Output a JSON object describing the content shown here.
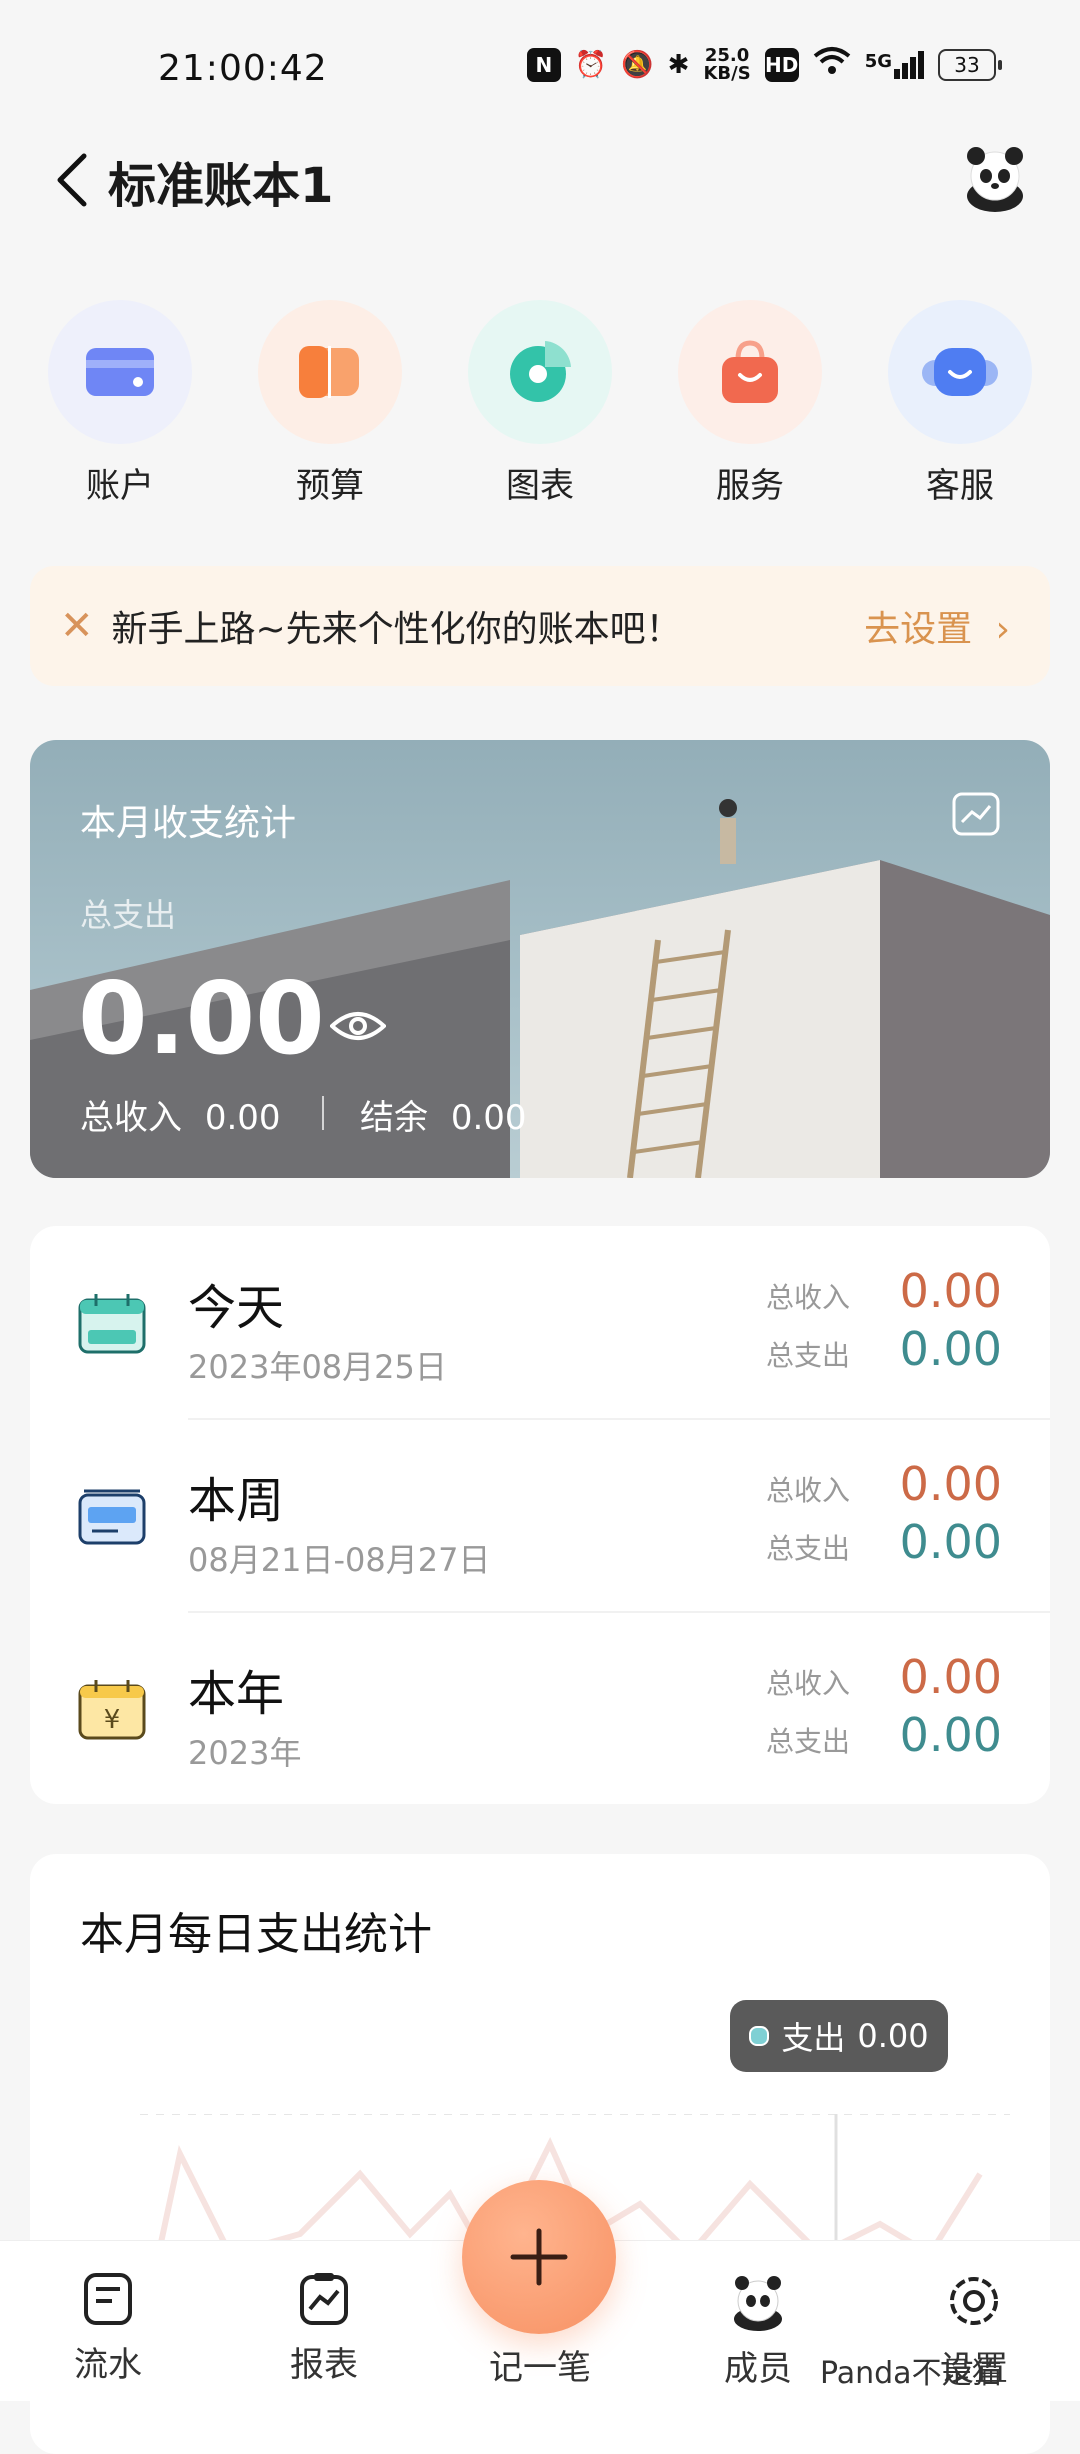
{
  "status_bar": {
    "time": "21:00:42",
    "icons": [
      "nfc-icon",
      "alarm-icon",
      "mute-icon",
      "bluetooth-icon"
    ],
    "net_speed_value": "25.0",
    "net_speed_unit": "KB/S",
    "hd": "HD",
    "network": "5G",
    "battery": "33"
  },
  "header": {
    "title": "标准账本1"
  },
  "quick_actions": [
    {
      "label": "账户",
      "icon": "card-icon",
      "color": "#6f86f5",
      "bg": "#eef0fb"
    },
    {
      "label": "预算",
      "icon": "budget-icon",
      "color": "#f77f3c",
      "bg": "#fdeee6"
    },
    {
      "label": "图表",
      "icon": "pie-chart-icon",
      "color": "#33c3a9",
      "bg": "#e6f7f3"
    },
    {
      "label": "服务",
      "icon": "bag-icon",
      "color": "#f1694f",
      "bg": "#fdeee8"
    },
    {
      "label": "客服",
      "icon": "headset-icon",
      "color": "#4f7df2",
      "bg": "#e9f0fc"
    }
  ],
  "banner": {
    "text": "新手上路~先来个性化你的账本吧！",
    "action": "去设置"
  },
  "monthly": {
    "title": "本月收支统计",
    "expense_label": "总支出",
    "expense_value": "0.00",
    "income_label": "总收入",
    "income_value": "0.00",
    "balance_label": "结余",
    "balance_value": "0.00"
  },
  "periods": [
    {
      "name": "今天",
      "date": "2023年08月25日",
      "income_label": "总收入",
      "income": "0.00",
      "expense_label": "总支出",
      "expense": "0.00",
      "icon": "calendar-today-icon"
    },
    {
      "name": "本周",
      "date": "08月21日-08月27日",
      "income_label": "总收入",
      "income": "0.00",
      "expense_label": "总支出",
      "expense": "0.00",
      "icon": "calendar-week-icon"
    },
    {
      "name": "本年",
      "date": "2023年",
      "income_label": "总收入",
      "income": "0.00",
      "expense_label": "总支出",
      "expense": "0.00",
      "icon": "calendar-year-icon"
    }
  ],
  "daily_chart": {
    "title": "本月每日支出统计",
    "tooltip_label": "支出",
    "tooltip_value": "0.00"
  },
  "colors": {
    "income": "#cc6a47",
    "expense": "#3f8c8f",
    "accent": "#f79163"
  },
  "nav": {
    "items": [
      {
        "label": "流水",
        "icon": "ledger-icon"
      },
      {
        "label": "报表",
        "icon": "report-icon"
      },
      {
        "label": "记一笔",
        "icon": "plus-icon"
      },
      {
        "label": "成员",
        "icon": "member-icon"
      },
      {
        "label": "设置",
        "icon": "settings-icon"
      }
    ]
  },
  "watermark": "Panda不是猫"
}
